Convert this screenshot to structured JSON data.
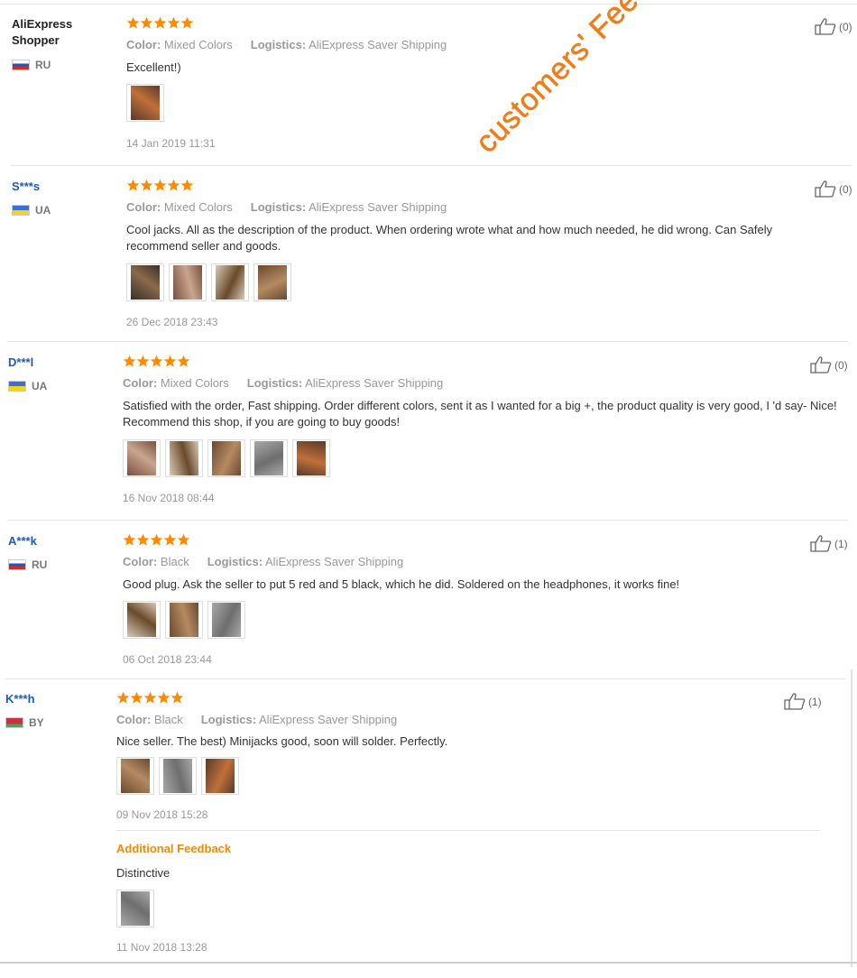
{
  "reviews": [
    {
      "user": "AliExpress Shopper",
      "user_style": "black",
      "country": "RU",
      "flag": "ru",
      "stars": 5,
      "color_label": "Color:",
      "color_value": "Mixed Colors",
      "logistics_label": "Logistics:",
      "logistics_value": "AliExpress Saver Shipping",
      "text": "Excellent!)",
      "photos": 1,
      "date": "14 Jan 2019 11:31",
      "helpful": "(0)"
    },
    {
      "user": "S***s",
      "user_style": "blue",
      "country": "UA",
      "flag": "ua",
      "stars": 5,
      "color_label": "Color:",
      "color_value": "Mixed Colors",
      "logistics_label": "Logistics:",
      "logistics_value": "AliExpress Saver Shipping",
      "text": "Cool jacks. All as the description of the product. When ordering wrote what and how much needed, he did wrong. Can Safely recommend seller and goods.",
      "photos": 4,
      "date": "26 Dec 2018 23:43",
      "helpful": "(0)"
    },
    {
      "user": "D***l",
      "user_style": "blue",
      "country": "UA",
      "flag": "ua",
      "stars": 5,
      "color_label": "Color:",
      "color_value": "Mixed Colors",
      "logistics_label": "Logistics:",
      "logistics_value": "AliExpress Saver Shipping",
      "text": "Satisfied with the order, Fast shipping. Order different colors, sent it as I wanted for a big +, the product quality is very good, I 'd say- Nice! Recommend this shop, if you are going to buy goods!",
      "photos": 5,
      "date": "16 Nov 2018 08:44",
      "helpful": "(0)"
    },
    {
      "user": "A***k",
      "user_style": "blue",
      "country": "RU",
      "flag": "ru",
      "stars": 5,
      "color_label": "Color:",
      "color_value": "Black",
      "logistics_label": "Logistics:",
      "logistics_value": "AliExpress Saver Shipping",
      "text": "Good plug. Ask the seller to put 5 red and 5 black, which he did. Soldered on the headphones, it works fine!",
      "photos": 3,
      "date": "06 Oct 2018 23:44",
      "helpful": "(1)"
    },
    {
      "user": "K***h",
      "user_style": "blue",
      "country": "BY",
      "flag": "by",
      "stars": 5,
      "color_label": "Color:",
      "color_value": "Black",
      "logistics_label": "Logistics:",
      "logistics_value": "AliExpress Saver Shipping",
      "text": "Nice seller. The best) Minijacks good, soon will solder. Perfectly.",
      "photos": 3,
      "date": "09 Nov 2018 15:28",
      "helpful": "(1)",
      "additional": {
        "title": "Additional Feedback",
        "text": "Distinctive",
        "photos": 1,
        "date": "11 Nov 2018 13:28"
      }
    }
  ],
  "watermark": "customers' Feedback",
  "colors": {
    "star": "#ff8a00",
    "username_blue": "#1a5bb8",
    "accent_orange": "#f08a0c",
    "watermark": "#ee7d1b"
  },
  "icons": {
    "star": "star-icon",
    "helpful": "thumbs-up-icon"
  }
}
